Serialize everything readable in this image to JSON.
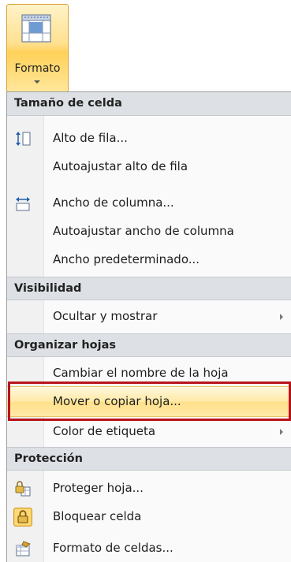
{
  "ribbon": {
    "button_label": "Formato",
    "icon": "format-cells-icon"
  },
  "menu": {
    "sections": [
      {
        "header": "Tamaño de celda",
        "items": [
          {
            "label": "Alto de fila...",
            "icon": "row-height-icon"
          },
          {
            "label": "Autoajustar alto de fila",
            "icon": ""
          },
          {
            "label": "Ancho de columna...",
            "icon": "column-width-icon"
          },
          {
            "label": "Autoajustar ancho de columna",
            "icon": ""
          },
          {
            "label": "Ancho predeterminado...",
            "icon": ""
          }
        ]
      },
      {
        "header": "Visibilidad",
        "items": [
          {
            "label": "Ocultar y mostrar",
            "icon": "",
            "submenu": true
          }
        ]
      },
      {
        "header": "Organizar hojas",
        "items": [
          {
            "label": "Cambiar el nombre de la hoja",
            "icon": ""
          },
          {
            "label": "Mover o copiar hoja...",
            "icon": "",
            "highlighted": true
          },
          {
            "label": "Color de etiqueta",
            "icon": "",
            "submenu": true
          }
        ]
      },
      {
        "header": "Protección",
        "items": [
          {
            "label": "Proteger hoja...",
            "icon": "protect-sheet-icon"
          },
          {
            "label": "Bloquear celda",
            "icon": "lock-icon"
          },
          {
            "label": "Formato de celdas...",
            "icon": "format-cells-dialog-icon"
          }
        ]
      }
    ]
  },
  "colors": {
    "highlight": "#ffe9a6",
    "emphasis_frame": "#b8141b",
    "section_header_bg": "#dde0e4"
  }
}
